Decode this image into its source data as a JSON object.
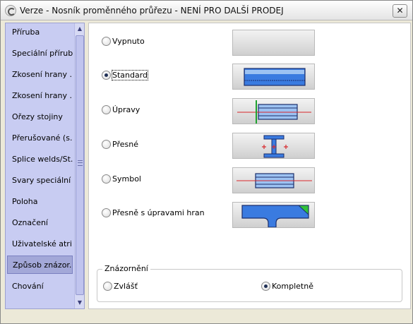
{
  "window": {
    "title": "Verze - Nosník proměnného průřezu - NENÍ PRO DALŠÍ PRODEJ",
    "close_glyph": "✕"
  },
  "sidebar": {
    "items": [
      {
        "label": "Příruba"
      },
      {
        "label": "Speciální příruby"
      },
      {
        "label": "Zkosení hrany ..."
      },
      {
        "label": "Zkosení hrany ..."
      },
      {
        "label": "Ořezy stojiny"
      },
      {
        "label": "Přerušované (s..."
      },
      {
        "label": "Splice welds/St..."
      },
      {
        "label": "Svary speciální"
      },
      {
        "label": "Poloha"
      },
      {
        "label": "Označení"
      },
      {
        "label": "Uživatelské atri..."
      },
      {
        "label": "Způsob znázor...",
        "selected": true
      },
      {
        "label": "Chování"
      }
    ],
    "scroll_up_glyph": "▲",
    "scroll_down_glyph": "▼"
  },
  "display_options": [
    {
      "label": "Vypnuto",
      "checked": false,
      "icon": "preview-off"
    },
    {
      "label": "Standard",
      "checked": true,
      "icon": "preview-standard"
    },
    {
      "label": "Úpravy",
      "checked": false,
      "icon": "preview-modifications"
    },
    {
      "label": "Přesné",
      "checked": false,
      "icon": "preview-exact"
    },
    {
      "label": "Symbol",
      "checked": false,
      "icon": "preview-symbol"
    },
    {
      "label": "Přesně s úpravami hran",
      "checked": false,
      "icon": "preview-exact-with-edge-modifications"
    }
  ],
  "representation": {
    "title": "Znázornění",
    "options": [
      {
        "label": "Zvlášť",
        "checked": false
      },
      {
        "label": "Kompletně",
        "checked": true
      }
    ]
  },
  "colors": {
    "profile_fill": "#3a7be0",
    "profile_light": "#9cc2f2",
    "outline": "#1b2e6b",
    "axis_line": "#d8262a",
    "green_marker": "#1fa22f",
    "edge_green": "#32c23a"
  }
}
